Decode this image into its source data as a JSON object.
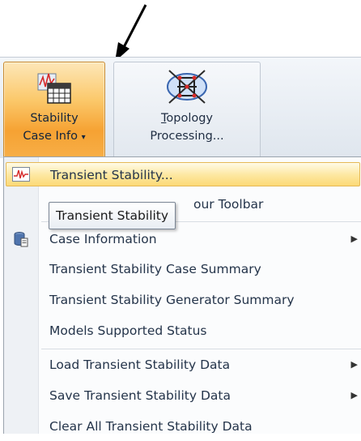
{
  "ribbon": {
    "stability_button": {
      "line1": "Stability",
      "line2": "Case Info",
      "dropdown_glyph": "▾"
    },
    "topology_button": {
      "line1": "Topology",
      "line1_accel": "T",
      "line1_rest": "opology",
      "line2": "Processing..."
    }
  },
  "menu": {
    "items": [
      {
        "label": "Transient Stability...",
        "icon": "waveform-icon",
        "highlighted": true
      },
      {
        "label": "our Toolbar",
        "partially_hidden": true
      },
      {
        "label": "Case Information",
        "icon": "database-case-icon",
        "submenu": true
      },
      {
        "label": "Transient Stability Case Summary"
      },
      {
        "label": "Transient Stability Generator Summary"
      },
      {
        "label": "Models Supported Status"
      },
      {
        "label": "Load Transient Stability Data",
        "submenu": true
      },
      {
        "label": "Save Transient Stability Data",
        "submenu": true
      },
      {
        "label": "Clear All Transient Stability Data"
      }
    ],
    "submenu_glyph": "▶"
  },
  "tooltip": {
    "text": "Transient Stability"
  },
  "colors": {
    "ribbon_active": "#f6a233",
    "menu_highlight": "#fde79f",
    "menu_border": "#9aa3ad"
  }
}
